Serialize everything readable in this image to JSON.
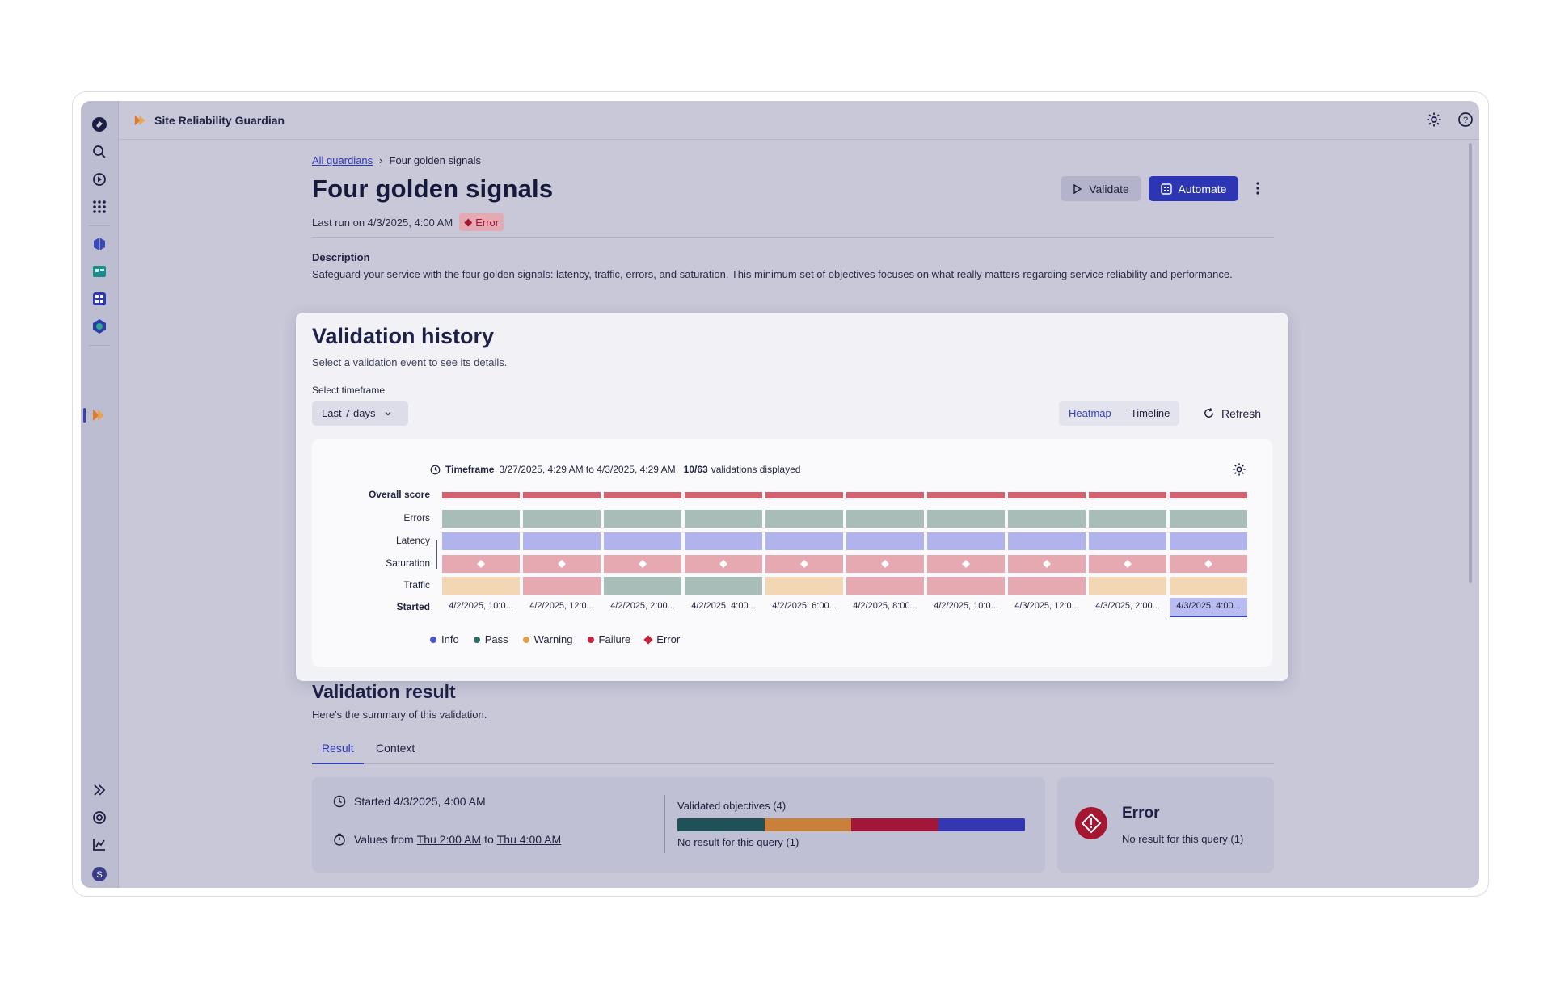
{
  "app": {
    "title": "Site Reliability Guardian"
  },
  "breadcrumb": {
    "link": "All guardians",
    "current": "Four golden signals"
  },
  "page": {
    "title": "Four golden signals",
    "last_run": "Last run on 4/3/2025, 4:00 AM",
    "status": "Error",
    "validate_label": "Validate",
    "automate_label": "Automate",
    "description_heading": "Description",
    "description": "Safeguard your service with the four golden signals: latency, traffic, errors, and saturation. This minimum set of objectives focuses on what really matters regarding service reliability and performance."
  },
  "history": {
    "title": "Validation history",
    "subtitle": "Select a validation event to see its details.",
    "timeframe_label": "Select timeframe",
    "timeframe_value": "Last 7 days",
    "view_heatmap": "Heatmap",
    "view_timeline": "Timeline",
    "refresh_label": "Refresh",
    "timeframe_prefix": "Timeframe",
    "timeframe_range": "3/27/2025, 4:29 AM to 4/3/2025, 4:29 AM",
    "count": "10/63",
    "count_suffix": "validations displayed"
  },
  "chart_data": {
    "type": "heatmap",
    "rows": [
      "Overall score",
      "Errors",
      "Latency",
      "Saturation",
      "Traffic"
    ],
    "started_label": "Started",
    "columns": [
      "4/2/2025, 10:0...",
      "4/2/2025, 12:0...",
      "4/2/2025, 2:00...",
      "4/2/2025, 4:00...",
      "4/2/2025, 6:00...",
      "4/2/2025, 8:00...",
      "4/2/2025, 10:0...",
      "4/3/2025, 12:0...",
      "4/3/2025, 2:00...",
      "4/3/2025, 4:00..."
    ],
    "selected_column": 9,
    "cells": {
      "Overall score": [
        "Failure",
        "Failure",
        "Failure",
        "Failure",
        "Failure",
        "Failure",
        "Failure",
        "Failure",
        "Failure",
        "Failure"
      ],
      "Errors": [
        "Pass",
        "Pass",
        "Pass",
        "Pass",
        "Pass",
        "Pass",
        "Pass",
        "Pass",
        "Pass",
        "Pass"
      ],
      "Latency": [
        "Info",
        "Info",
        "Info",
        "Info",
        "Info",
        "Info",
        "Info",
        "Info",
        "Info",
        "Info"
      ],
      "Saturation": [
        "Error",
        "Error",
        "Error",
        "Error",
        "Error",
        "Error",
        "Error",
        "Error",
        "Error",
        "Error"
      ],
      "Traffic": [
        "Warning",
        "Failure",
        "Pass",
        "Pass",
        "Warning",
        "Failure",
        "Failure",
        "Failure",
        "Warning",
        "Warning"
      ]
    },
    "legend": [
      {
        "label": "Info",
        "color": "#4b55c8"
      },
      {
        "label": "Pass",
        "color": "#2f6b62"
      },
      {
        "label": "Warning",
        "color": "#e0a04a"
      },
      {
        "label": "Failure",
        "color": "#c4223f"
      },
      {
        "label": "Error",
        "color": "#c4223f"
      }
    ],
    "colors": {
      "Info": "#b1b4ec",
      "Pass": "#a8bdb8",
      "Warning": "#f3d6b4",
      "Failure": "#e6a8b1",
      "Error": "#e6a8b1",
      "OverallFailure": "#d5606f"
    }
  },
  "result": {
    "title": "Validation result",
    "subtitle": "Here's the summary of this validation.",
    "tab_result": "Result",
    "tab_context": "Context",
    "started": "Started 4/3/2025, 4:00 AM",
    "values_prefix": "Values from",
    "values_from": "Thu 2:00 AM",
    "values_to_word": "to",
    "values_to": "Thu 4:00 AM",
    "objectives_title": "Validated objectives (4)",
    "objectives_colors": [
      "#1e5258",
      "#c9803a",
      "#a2163a",
      "#3437b2"
    ],
    "objectives_note": "No result for this query (1)",
    "error_title": "Error",
    "error_note": "No result for this query (1)"
  }
}
